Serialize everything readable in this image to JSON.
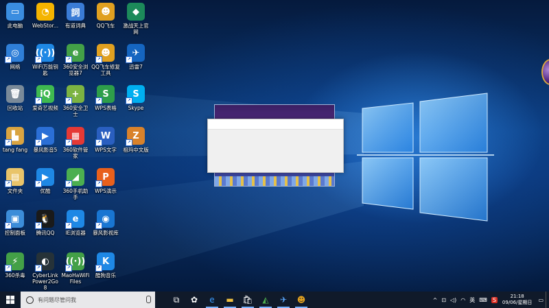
{
  "desktop": {
    "icons": [
      {
        "label": "此电脑",
        "color": "#3a8de0",
        "glyph": "▭",
        "icon": "computer-icon"
      },
      {
        "label": "WebStor...",
        "color": "#f4b400",
        "glyph": "◔",
        "icon": "webstorage-icon"
      },
      {
        "label": "有道词典",
        "color": "#3a7bd5",
        "glyph": "詞",
        "icon": "youdao-dict-icon"
      },
      {
        "label": "QQ飞车",
        "color": "#e0a020",
        "glyph": "☻",
        "icon": "qq-speed-icon"
      },
      {
        "label": "激战天上官网",
        "color": "#1c8a5a",
        "glyph": "◆",
        "icon": "game-site-icon"
      },
      {
        "label": "网络",
        "color": "#2f7fd8",
        "glyph": "◎",
        "icon": "network-icon"
      },
      {
        "label": "WiFi万能钥匙",
        "color": "#1e88e5",
        "glyph": "((·))",
        "icon": "wifi-key-icon"
      },
      {
        "label": "360安全浏览器7",
        "color": "#43a047",
        "glyph": "e",
        "icon": "360-browser-icon"
      },
      {
        "label": "QQ飞车修复工具",
        "color": "#e0a020",
        "glyph": "☻",
        "icon": "qq-speed-repair-icon"
      },
      {
        "label": "迅雷7",
        "color": "#1565c0",
        "glyph": "✈",
        "icon": "thunder-icon"
      },
      {
        "label": "回收站",
        "color": "#7a8a99",
        "glyph": "🗑",
        "icon": "recycle-bin-icon"
      },
      {
        "label": "爱奇艺视频",
        "color": "#3fb950",
        "glyph": "iQ",
        "icon": "iqiyi-icon"
      },
      {
        "label": "360安全卫士",
        "color": "#7cb342",
        "glyph": "+",
        "icon": "360-safe-icon"
      },
      {
        "label": "WPS表格",
        "color": "#2e9e4a",
        "glyph": "S",
        "icon": "wps-sheet-icon"
      },
      {
        "label": "Skype",
        "color": "#00aff0",
        "glyph": "S",
        "icon": "skype-icon"
      },
      {
        "label": "tang fang",
        "color": "#d9a441",
        "glyph": "▙",
        "icon": "user-folder-icon"
      },
      {
        "label": "暴风影音5",
        "color": "#2b6fd6",
        "glyph": "▶",
        "icon": "baofeng-icon"
      },
      {
        "label": "360软件管家",
        "color": "#e53935",
        "glyph": "▦",
        "icon": "360-software-icon"
      },
      {
        "label": "WPS文字",
        "color": "#2a5fc0",
        "glyph": "W",
        "icon": "wps-writer-icon"
      },
      {
        "label": "祖玛中文版",
        "color": "#d9822b",
        "glyph": "Z",
        "icon": "zuma-icon"
      },
      {
        "label": "文件夹",
        "color": "#e9c46a",
        "glyph": "▤",
        "icon": "folder-icon"
      },
      {
        "label": "优酷",
        "color": "#1e88e5",
        "glyph": "▶",
        "icon": "youku-icon"
      },
      {
        "label": "360手机助手",
        "color": "#4caf50",
        "glyph": "◢",
        "icon": "360-mobile-icon"
      },
      {
        "label": "WPS演示",
        "color": "#e8601c",
        "glyph": "P",
        "icon": "wps-present-icon"
      },
      {
        "label": "控制面板",
        "color": "#3c8dd9",
        "glyph": "▣",
        "icon": "control-panel-icon"
      },
      {
        "label": "腾讯QQ",
        "color": "#1a1a1a",
        "glyph": "🐧",
        "icon": "qq-icon"
      },
      {
        "label": "IE浏览器",
        "color": "#1e88e5",
        "glyph": "e",
        "icon": "ie-icon"
      },
      {
        "label": "暴风影视库",
        "color": "#1976d2",
        "glyph": "◉",
        "icon": "baofeng-library-icon"
      },
      {
        "label": "360杀毒",
        "color": "#43a047",
        "glyph": "⚡",
        "icon": "360-antivirus-icon"
      },
      {
        "label": "CyberLink Power2Go 8",
        "color": "#263238",
        "glyph": "◐",
        "icon": "cyberlink-icon"
      },
      {
        "label": "MaoHaWiFi Files",
        "color": "#43a047",
        "glyph": "((·))",
        "icon": "maohawifi-icon"
      },
      {
        "label": "酷狗音乐",
        "color": "#1e88e5",
        "glyph": "K",
        "icon": "kugou-icon"
      }
    ]
  },
  "taskbar": {
    "search_placeholder": "有问题尽管问我",
    "apps": [
      {
        "icon": "task-view-icon",
        "glyph": "⧉",
        "color": "#ffffff"
      },
      {
        "icon": "pinwheel-icon",
        "glyph": "✿",
        "color": "#ffffff"
      },
      {
        "icon": "edge-icon",
        "glyph": "e",
        "color": "#3b9cff"
      },
      {
        "icon": "file-explorer-icon",
        "glyph": "▬",
        "color": "#f0c040"
      },
      {
        "icon": "store-icon",
        "glyph": "🛍",
        "color": "#ffffff"
      },
      {
        "icon": "app-green-icon",
        "glyph": "◭",
        "color": "#4caf50"
      },
      {
        "icon": "thunder-taskbar-icon",
        "glyph": "✈",
        "color": "#5aa8ff"
      },
      {
        "icon": "qq-speed-taskbar-icon",
        "glyph": "☻",
        "color": "#e0a020"
      }
    ],
    "tray": {
      "chevron": "^",
      "ime": "英",
      "antivirus": "S",
      "time": "21:18",
      "date": "09/06/星期日"
    }
  }
}
